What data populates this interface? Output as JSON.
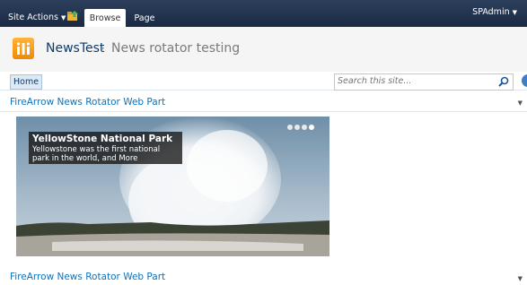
{
  "ribbon": {
    "site_actions": "Site Actions",
    "tabs": [
      "Browse",
      "Page"
    ],
    "user": "SPAdmin"
  },
  "title_area": {
    "site_title": "NewsTest",
    "separator": "›",
    "page_title": "News rotator testing"
  },
  "linkbar": {
    "home": "Home",
    "search_placeholder": "Search this site..."
  },
  "webparts": [
    {
      "title": "FireArrow News Rotator Web Part",
      "slide": {
        "headline": "YellowStone National Park",
        "summary": "Yellowstone was the first national park in the world, and More"
      },
      "pager": {
        "count": 4,
        "active": 4
      }
    },
    {
      "title": "FireArrow News Rotator Web Part"
    }
  ],
  "colors": {
    "ribbon": "#1f2f4a",
    "link": "#0f72ba",
    "title": "#0c3c6e"
  }
}
